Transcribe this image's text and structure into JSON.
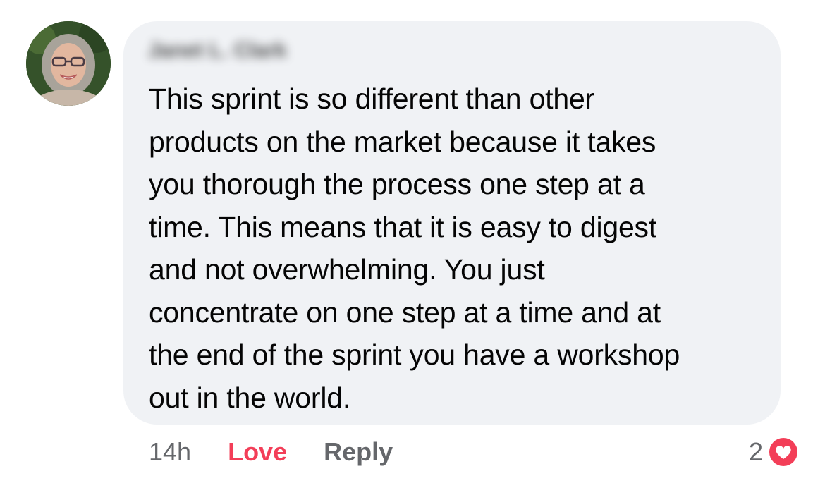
{
  "comment": {
    "author": "Janet L. Clark",
    "text": "This sprint is so different than other\nproducts on the market because it takes\nyou thorough the process one step at a\ntime. This means that it is easy to digest\nand not overwhelming. You just\nconcentrate on one step at a time and at\nthe end of the sprint you have a workshop\nout in the world.",
    "timestamp": "14h",
    "love_label": "Love",
    "reply_label": "Reply",
    "reaction_count": "2",
    "reaction_icon": "heart-icon"
  },
  "colors": {
    "bubble_bg": "#f0f2f5",
    "text": "#050505",
    "secondary_text": "#65676b",
    "love_red": "#f33e58"
  }
}
